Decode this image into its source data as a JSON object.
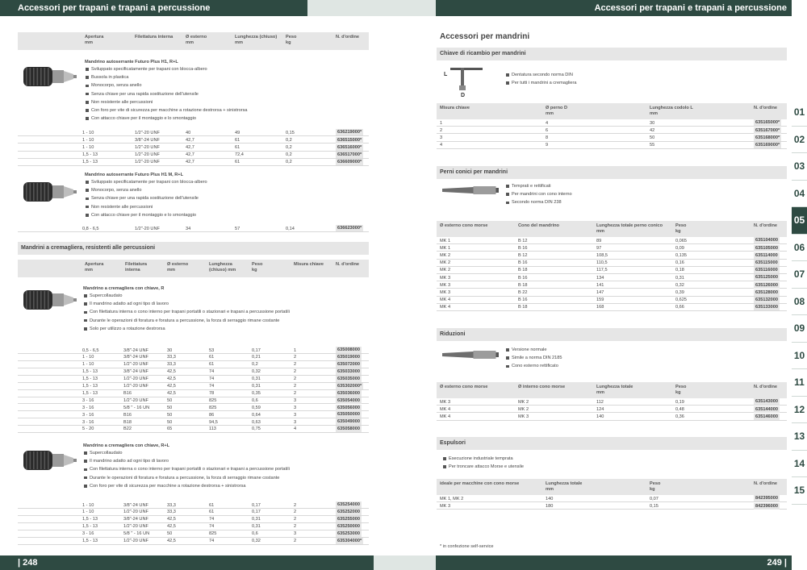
{
  "left_title": "Accessori per trapani e trapani a percussione",
  "right_title": "Accessori per trapani e trapani a percussione",
  "page_left": "| 248",
  "page_right": "249 |",
  "section_heading": "Accessori per mandrini",
  "sidebar_numbers": [
    "01",
    "02",
    "03",
    "04",
    "05",
    "06",
    "07",
    "08",
    "09",
    "10",
    "11",
    "12",
    "13",
    "14",
    "15"
  ],
  "active_tab": "05",
  "t1_headers": [
    "Apertura\nmm",
    "Filettatura interna",
    "Ø esterno\nmm",
    "Lunghezza (chiuso)\nmm",
    "Peso\nkg",
    "N. d'ordine"
  ],
  "p1": {
    "title": "Mandrino autoserrante Futuro Plus H1, R+L",
    "bullets": [
      "Sviluppato specificatamente per trapani con blocca-albero",
      "Bussola in plastica",
      "Monocorpo, senza anello",
      "Senza chiave per una rapida sostituzione dell'utensile",
      "Non resistente alle percussioni",
      "Con foro per vite di sicurezza per macchine a rotazione destrorsa + sinistrorsa",
      "Con attacco chiave per il montaggio e lo smontaggio"
    ]
  },
  "t1_rows": [
    [
      "1 - 10",
      "1/2\"-20 UNF",
      "40",
      "49",
      "0,15",
      "636219000*"
    ],
    [
      "1 - 10",
      "3/8\"-24 UNF",
      "42,7",
      "61",
      "0,2",
      "636515000*"
    ],
    [
      "1 - 10",
      "1/2\"-20 UNF",
      "42,7",
      "61",
      "0,2",
      "636516000*"
    ],
    [
      "1,5 - 13",
      "1/2\"-20 UNF",
      "42,7",
      "72,4",
      "0,2",
      "636517000*"
    ],
    [
      "1,5 - 13",
      "1/2\"-20 UNF",
      "42,7",
      "61",
      "0,2",
      "636609000*"
    ]
  ],
  "p2": {
    "title": "Mandrino autoserrante Futuro Plus H1 M, R+L",
    "bullets": [
      "Sviluppato specificatamente per trapani con blocca-albero",
      "Monocorpo, senza anello",
      "Senza chiave per una rapida sostituzione dell'utensile",
      "Non resistente alle percussioni",
      "Con attacco chiave per il montaggio e lo smontaggio"
    ]
  },
  "t2_rows": [
    [
      "0,8 - 6,5",
      "1/2\"-20 UNF",
      "34",
      "57",
      "0,14",
      "636623000*"
    ]
  ],
  "sect_rack": "Mandrini a cremagliera, resistenti alle percussioni",
  "t3_headers": [
    "Apertura\nmm",
    "Filettatura\ninterna",
    "Ø esterno\nmm",
    "Lunghezza\n(chiuso) mm",
    "Peso\nkg",
    "Misura chiave",
    "N. d'ordine"
  ],
  "p3": {
    "title": "Mandrino a cremagliera con chiave, R",
    "bullets": [
      "Supercollaudato",
      "Il mandrino adatto ad ogni tipo di lavoro",
      "Con filettatura interna o cono interno per trapani portatili o stazionari e trapani a percussione portatili",
      "Durante le operazioni di foratura e foratura a percussione, la forza di serraggio rimane costante",
      "Solo per utilizzo a rotazione destrorsa"
    ]
  },
  "t3_rows": [
    [
      "0,5 - 6,5",
      "3/8\"-24 UNF",
      "30",
      "53",
      "0,17",
      "1",
      "635008000"
    ],
    [
      "1 - 10",
      "3/8\"-24 UNF",
      "33,3",
      "61",
      "0,21",
      "2",
      "635019000"
    ],
    [
      "1 - 10",
      "1/2\"-20 UNF",
      "33,3",
      "61",
      "0,2",
      "2",
      "635072000"
    ],
    [
      "1,5 - 13",
      "3/8\"-24 UNF",
      "42,5",
      "74",
      "0,32",
      "2",
      "635033000"
    ],
    [
      "1,5 - 13",
      "1/2\"-20 UNF",
      "42,5",
      "74",
      "0,31",
      "2",
      "635035000"
    ],
    [
      "1,5 - 13",
      "1/2\"-20 UNF",
      "42,5",
      "74",
      "0,31",
      "2",
      "635302000*"
    ],
    [
      "1,5 - 13",
      "B16",
      "42,5",
      "78",
      "0,35",
      "2",
      "635036000"
    ],
    [
      "3 - 16",
      "1/2\"-20 UNF",
      "50",
      "825",
      "0,6",
      "3",
      "635054000"
    ],
    [
      "3 - 16",
      "5/8 \" - 16 UN",
      "50",
      "825",
      "0,59",
      "3",
      "635056000"
    ],
    [
      "3 - 16",
      "B16",
      "50",
      "86",
      "0,64",
      "3",
      "635050000"
    ],
    [
      "3 - 16",
      "B18",
      "50",
      "94,5",
      "0,63",
      "3",
      "635049000"
    ],
    [
      "5 - 20",
      "B22",
      "65",
      "113",
      "0,75",
      "4",
      "635058000"
    ]
  ],
  "p4": {
    "title": "Mandrino a cremagliera con chiave, R+L",
    "bullets": [
      "Supercollaudato",
      "Il mandrino adatto ad ogni tipo di lavoro",
      "Con filettatura interna o cono interno per trapani portatili o stazionari e trapani a percussione portatili",
      "Durante le operazioni di foratura e foratura a percussione, la forza di serraggio rimane costante",
      "Con foro per vite di sicurezza per macchine a rotazione destrorsa + sinistrorsa"
    ]
  },
  "t4_rows": [
    [
      "1 - 10",
      "3/8\"-24 UNF",
      "33,3",
      "61",
      "0,17",
      "2",
      "635254000"
    ],
    [
      "1 - 10",
      "1/2\"-20 UNF",
      "33,3",
      "61",
      "0,17",
      "2",
      "635252000"
    ],
    [
      "1,5 - 13",
      "3/8\"-24 UNF",
      "42,5",
      "74",
      "0,31",
      "2",
      "635255000"
    ],
    [
      "1,5 - 13",
      "1/2\"-20 UNF",
      "42,5",
      "74",
      "0,31",
      "2",
      "635250000"
    ],
    [
      "3 - 16",
      "5/8 \" - 16 UN",
      "50",
      "825",
      "0,6",
      "3",
      "635253000"
    ],
    [
      "1,5 - 13",
      "1/2\"-20 UNF",
      "42,5",
      "74",
      "0,32",
      "2",
      "635304000*"
    ]
  ],
  "r1": {
    "title": "Chiave di ricambio per mandrini",
    "bullets": [
      "Dentatura secondo norma DIN",
      "Per tutti i mandrini a cremagliera"
    ],
    "label_l": "L",
    "label_d": "D",
    "headers": [
      "Misura chiave",
      "Ø perno D\nmm",
      "Lunghezza codolo L\nmm",
      "N. d'ordine"
    ],
    "rows": [
      [
        "1",
        "4",
        "30",
        "635165000*"
      ],
      [
        "2",
        "6",
        "42",
        "635167000*"
      ],
      [
        "3",
        "8",
        "50",
        "635168000*"
      ],
      [
        "4",
        "9",
        "55",
        "635169000*"
      ]
    ]
  },
  "r2": {
    "title": "Perni conici per mandrini",
    "bullets": [
      "Temprati e rettificati",
      "Per mandrini con cono interno",
      "Secondo norma DIN 238"
    ],
    "headers": [
      "Ø esterno cono morse",
      "Cono del mandrino",
      "Lunghezza totale perno conico\nmm",
      "Peso\nkg",
      "N. d'ordine"
    ],
    "rows": [
      [
        "MK 1",
        "B 12",
        "89",
        "0,065",
        "635104000"
      ],
      [
        "MK 1",
        "B 16",
        "97",
        "0,09",
        "635105000"
      ],
      [
        "MK 2",
        "B 12",
        "108,5",
        "0,135",
        "635114000"
      ],
      [
        "MK 2",
        "B 16",
        "110,5",
        "0,16",
        "635115000"
      ],
      [
        "MK 2",
        "B 18",
        "117,5",
        "0,18",
        "635116000"
      ],
      [
        "MK 3",
        "B 16",
        "134",
        "0,31",
        "635125000"
      ],
      [
        "MK 3",
        "B 18",
        "141",
        "0,32",
        "635126000"
      ],
      [
        "MK 3",
        "B 22",
        "147",
        "0,39",
        "635128000"
      ],
      [
        "MK 4",
        "B 16",
        "159",
        "0,625",
        "635132000"
      ],
      [
        "MK 4",
        "B 18",
        "168",
        "0,66",
        "635133000"
      ]
    ]
  },
  "r3": {
    "title": "Riduzioni",
    "bullets": [
      "Versione normale",
      "Simile a norma DIN 2185",
      "Cono esterno rettificato"
    ],
    "headers": [
      "Ø esterno cono morse",
      "Ø interno cono morse",
      "Lunghezza totale\nmm",
      "Peso\nkg",
      "N. d'ordine"
    ],
    "rows": [
      [
        "MK 3",
        "MK 2",
        "112",
        "0,19",
        "635143000"
      ],
      [
        "MK 4",
        "MK 2",
        "124",
        "0,48",
        "635144000"
      ],
      [
        "MK 4",
        "MK 3",
        "140",
        "0,36",
        "635146000"
      ]
    ]
  },
  "r4": {
    "title": "Espulsori",
    "bullets": [
      "Esecuzione industriale temprata",
      "Per troncare attacco Morse e utensile"
    ],
    "headers": [
      "ideale per macchine con cono morse",
      "Lunghezza totale\nmm",
      "Peso\nkg",
      "N. d'ordine"
    ],
    "rows": [
      [
        "MK 1, MK 2",
        "140",
        "0,07",
        "842395000"
      ],
      [
        "MK 3",
        "180",
        "0,15",
        "842396000"
      ]
    ]
  },
  "note": "* in confezione self-service",
  "colors": {
    "band": "#2e4a42",
    "header_bg": "#e6e6e6"
  }
}
